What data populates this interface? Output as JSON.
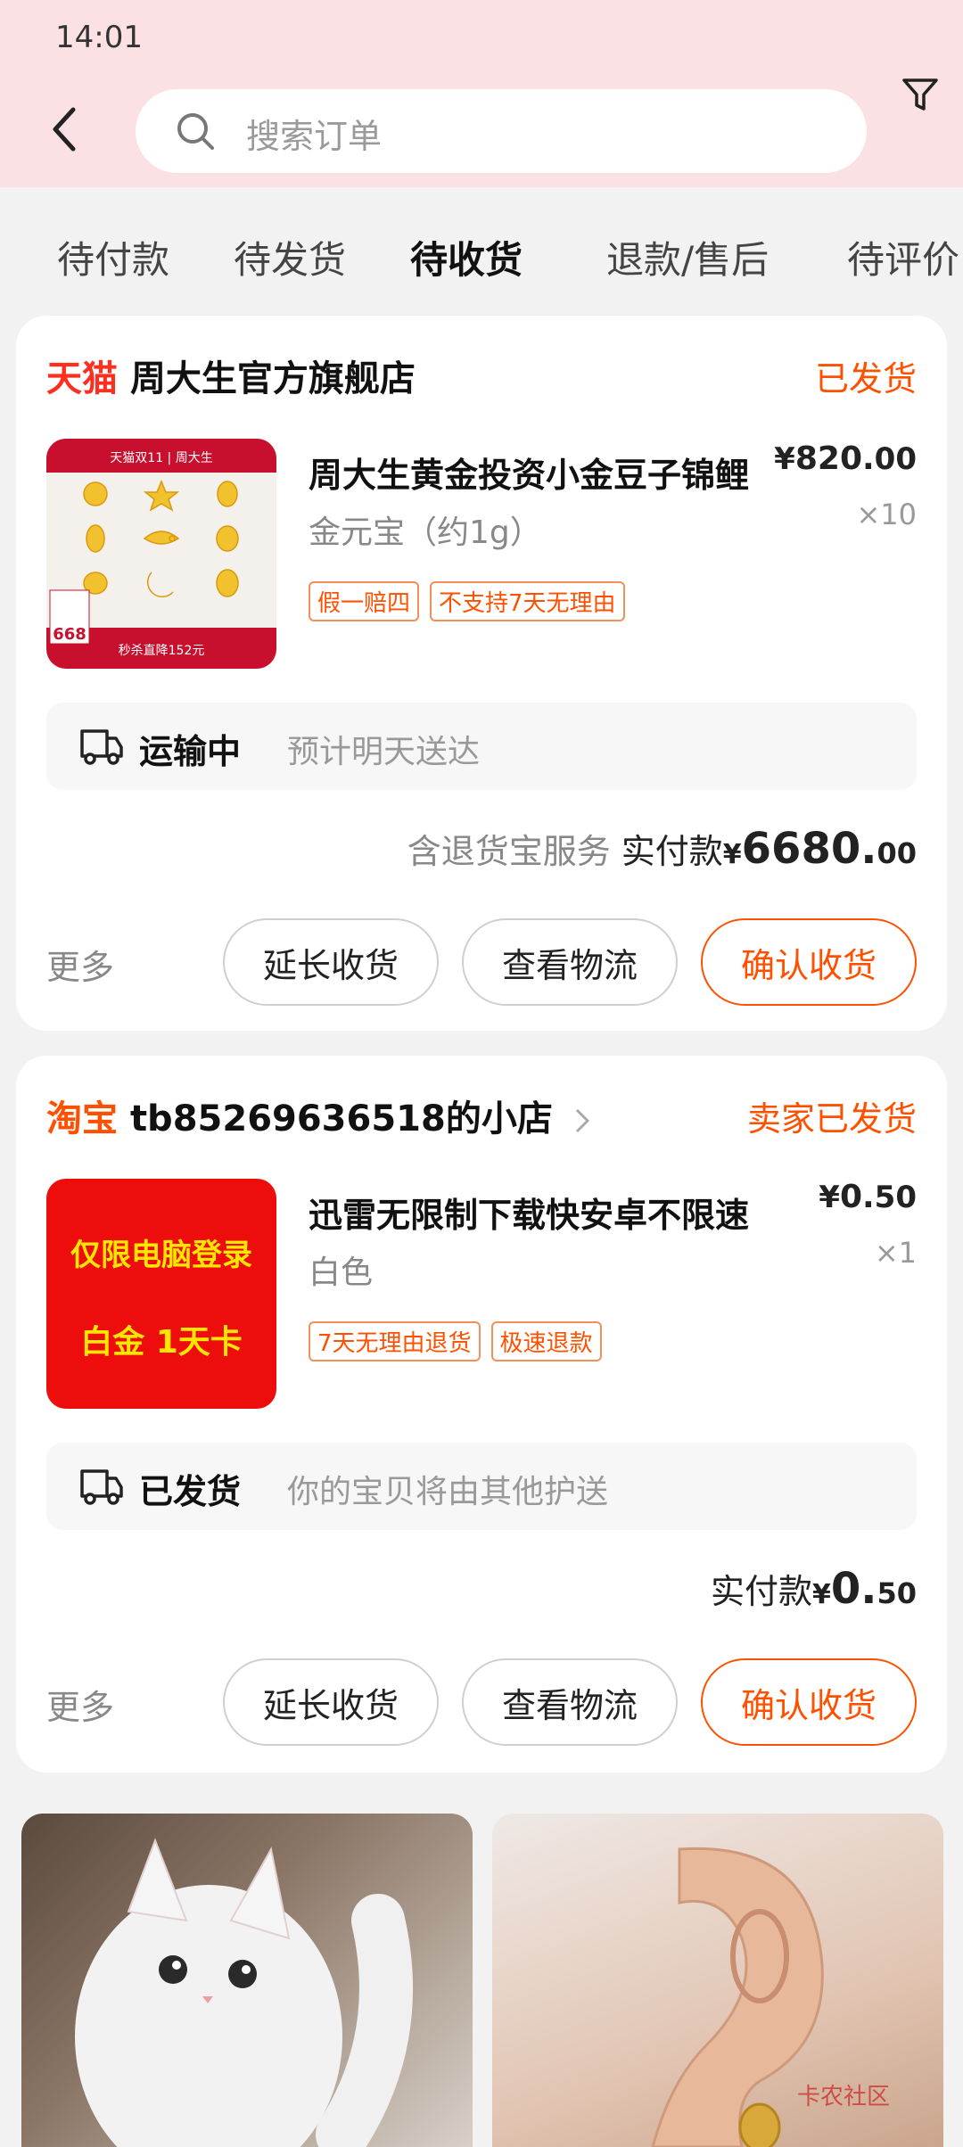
{
  "status_bar": {
    "time": "14:01"
  },
  "search": {
    "placeholder": "搜索订单"
  },
  "tabs": [
    "待付款",
    "待发货",
    "待收货",
    "退款/售后",
    "待评价"
  ],
  "orders": [
    {
      "platform": "天猫",
      "shop_name": "周大生官方旗舰店",
      "status": "已发货",
      "product": {
        "title": "周大生黄金投资小金豆子锦鲤",
        "spec": "金元宝（约1g）",
        "price_yen": "¥",
        "price_int": "820.",
        "price_dec": "00",
        "qty": "×10",
        "tags": [
          "假一赔四",
          "不支持7天无理由"
        ],
        "image_texts": {
          "brand": "天猫双11 | 周大生",
          "price": "668",
          "bottom": "秒杀直降152元"
        }
      },
      "logistics": {
        "status": "运输中",
        "desc": "预计明天送达"
      },
      "pay": {
        "service": "含退货宝服务",
        "label": "实付款",
        "yen": "¥",
        "int": "6680.",
        "dec": "00"
      },
      "more": "更多",
      "buttons": [
        "延长收货",
        "查看物流",
        "确认收货"
      ]
    },
    {
      "platform": "淘宝",
      "shop_name": "tb85269636518的小店",
      "status": "卖家已发货",
      "product": {
        "title": "迅雷无限制下载快安卓不限速",
        "spec": "白色",
        "price_yen": "¥",
        "price_int": "0.",
        "price_dec": "50",
        "qty": "×1",
        "tags": [
          "7天无理由退货",
          "极速退款"
        ],
        "image_texts": {
          "line1": "仅限电脑登录",
          "line2": "白金 1天卡"
        }
      },
      "logistics": {
        "status": "已发货",
        "desc": "你的宝贝将由其他护送"
      },
      "pay": {
        "service": "",
        "label": "实付款",
        "yen": "¥",
        "int": "0.",
        "dec": "50"
      },
      "more": "更多",
      "buttons": [
        "延长收货",
        "查看物流",
        "确认收货"
      ]
    }
  ],
  "watermark": "卡农社区",
  "colors": {
    "accent": "#ff5000",
    "tmall_red": "#ff2f20",
    "header_bg": "#fbe1e3"
  }
}
